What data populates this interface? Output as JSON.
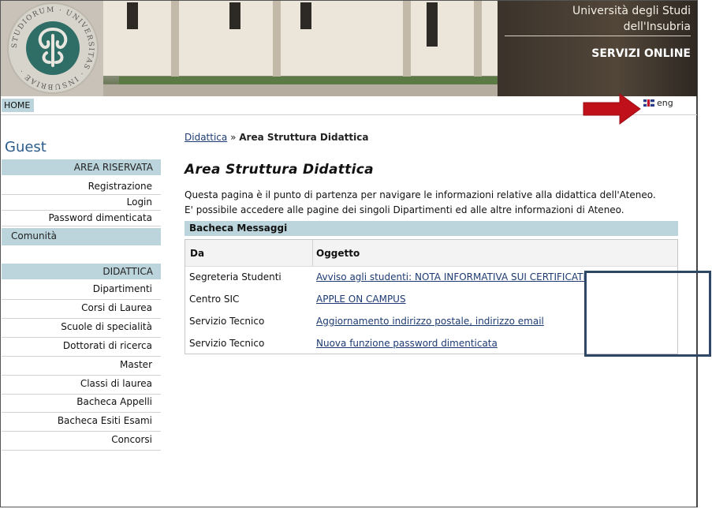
{
  "header": {
    "university_line1": "Università degli Studi",
    "university_line2": "dell'Insubria",
    "services": "SERVIZI ONLINE",
    "seal_text": "STUDIORUM UNIVERSITAS INSUBRIAE"
  },
  "topbar": {
    "home": "HOME",
    "lang": "eng"
  },
  "sidebar": {
    "user": "Guest",
    "area_riservata": "AREA RISERVATA",
    "area_items": [
      "Registrazione",
      "Login",
      "Password dimenticata"
    ],
    "comunita": "Comunità",
    "didattica": "DIDATTICA",
    "didattica_items": [
      "Dipartimenti",
      "Corsi di Laurea",
      "Scuole di specialità",
      "Dottorati di ricerca",
      "Master",
      "Classi di laurea",
      "Bacheca Appelli",
      "Bacheca Esiti Esami",
      "Concorsi"
    ]
  },
  "main": {
    "breadcrumb_link": "Didattica",
    "breadcrumb_sep": "»",
    "breadcrumb_current": "Area Struttura Didattica",
    "title": "Area Struttura Didattica",
    "intro": "Questa pagina è il punto di partenza per navigare le informazioni relative alla didattica dell'Ateneo. E' possibile accedere alle pagine dei singoli Dipartimenti ed alle altre informazioni di Ateneo.",
    "bacheca_title": "Bacheca Messaggi",
    "col_da": "Da",
    "col_oggetto": "Oggetto",
    "messages": [
      {
        "da": "Segreteria Studenti",
        "oggetto": "Avviso agli studenti: NOTA INFORMATIVA SUI CERTIFICATI"
      },
      {
        "da": "Centro SIC",
        "oggetto": "APPLE ON CAMPUS"
      },
      {
        "da": "Servizio Tecnico",
        "oggetto": "Aggiornamento indirizzo postale, indirizzo email"
      },
      {
        "da": "Servizio Tecnico",
        "oggetto": "Nuova funzione password dimenticata"
      }
    ]
  },
  "colors": {
    "accent": "#bcd5dc",
    "link": "#1d3b72",
    "arrow": "#c0111a",
    "highlight_box": "#2e4766"
  }
}
